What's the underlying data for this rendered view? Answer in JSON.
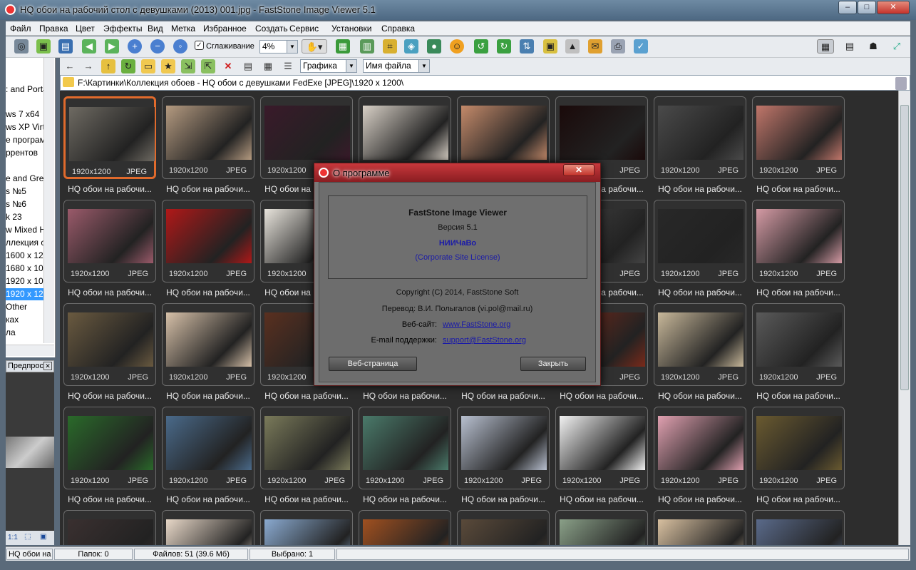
{
  "window": {
    "title": "HQ обои на рабочий стол с девушками (2013) 001.jpg  -  FastStone Image Viewer 5.1",
    "minimize": "–",
    "maximize": "□",
    "close": "✕"
  },
  "menu": [
    "Файл",
    "Правка",
    "Цвет",
    "Эффекты",
    "Вид",
    "Метка",
    "Избранное",
    "Создать",
    "Сервис",
    "Установки",
    "Справка"
  ],
  "toolbar": {
    "smoothing_label": "Сглаживание",
    "zoom_value": "4%",
    "filter_value": "Графика",
    "sort_value": "Имя файла"
  },
  "path": "F:\\Картинки\\Коллекция обоев - HQ обои с девушками  FedExe [JPEG]\\1920 x 1200\\",
  "tree": [
    {
      "label": ": and Porta",
      "hl": false
    },
    {
      "label": "ws 7 x64",
      "hl": false
    },
    {
      "label": "ws XP Virtu",
      "hl": false
    },
    {
      "label": "е програм",
      "hl": false
    },
    {
      "label": "ррентов",
      "hl": false
    },
    {
      "label": "е and Gree",
      "hl": false
    },
    {
      "label": "s №5",
      "hl": false
    },
    {
      "label": "s №6",
      "hl": false
    },
    {
      "label": "k 23",
      "hl": false
    },
    {
      "label": "w Mixed H",
      "hl": false
    },
    {
      "label": "ллекция о",
      "hl": false
    },
    {
      "label": "1600 x 120",
      "hl": false
    },
    {
      "label": "1680 x 105",
      "hl": false
    },
    {
      "label": "1920 x 108",
      "hl": false
    },
    {
      "label": "1920 x 120",
      "hl": true
    },
    {
      "label": "Other",
      "hl": false
    },
    {
      "label": "ках",
      "hl": false
    },
    {
      "label": "ла",
      "hl": false
    }
  ],
  "preview": {
    "header": "Предпрос",
    "ratio": "1:1"
  },
  "thumbs": {
    "resolution": "1920x1200",
    "format": "JPEG",
    "caption": "HQ обои на рабочи...",
    "colors": [
      [
        "#6e6a62",
        "#b49a80",
        "#3a1a2a",
        "#d8d0c6",
        "#c48a6a",
        "#1a0a0a",
        "#4a4a4a",
        "#c0766a"
      ],
      [
        "#9a5a6a",
        "#b01818",
        "#e8e4dc",
        "#cccccc",
        "#dddddd",
        "#444444",
        "#282828",
        "#d49aa4"
      ],
      [
        "#6a5a40",
        "#d6c0a8",
        "#5a3020",
        "#888888",
        "#999999",
        "#7a2a1a",
        "#c8b89a",
        "#5a5a5a"
      ],
      [
        "#2a6a2a",
        "#4a6a8a",
        "#7a7a5a",
        "#4a7a6a",
        "#b8c0d0",
        "#f2f2f2",
        "#e0a0b0",
        "#6a5a30"
      ],
      [
        "#3a3030",
        "#e8d8c8",
        "#8aaad0",
        "#a05020",
        "#5a4a3a",
        "#8aa088",
        "#d8c0a0",
        "#5a6a8a"
      ]
    ]
  },
  "status": {
    "file": "HQ обои на",
    "folders": "Папок: 0",
    "files": "Файлов: 51 (39.6 Мб)",
    "selected": "Выбрано: 1"
  },
  "about": {
    "title": "О программе",
    "close": "✕",
    "product": "FastStone Image Viewer",
    "version": "Версия 5.1",
    "registrant": "НИИЧаВо",
    "license": "(Corporate Site License)",
    "copyright": "Copyright (C) 2014, FastStone Soft",
    "translation": "Перевод: В.И. Полыгалов (vi.pol@mail.ru)",
    "website_label": "Веб-сайт:",
    "website": "www.FastStone.org",
    "email_label": "E-mail поддержки:",
    "email": "support@FastStone.org",
    "web_button": "Веб-страница",
    "close_button": "Закрыть"
  }
}
